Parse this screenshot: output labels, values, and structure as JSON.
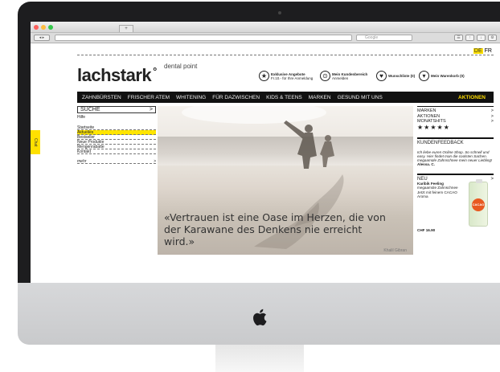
{
  "browser": {
    "tab_label": "+",
    "search_placeholder": "Google",
    "toolbar_icons": [
      "reader",
      "share",
      "download",
      "settings"
    ]
  },
  "site": {
    "lang": {
      "active": "DE",
      "other": "FR"
    },
    "logo": "lachstark",
    "logo_mark": "°",
    "logo_sub": "dental point",
    "header_links": [
      {
        "icon": "star-icon",
        "glyph": "★",
        "title": "Exklusive Angebote",
        "sub": "Fr.10.- für Ihre Anmeldung"
      },
      {
        "icon": "lock-icon",
        "glyph": "🔒",
        "title": "Mein Kundenbereich",
        "sub": "Anmelden"
      },
      {
        "icon": "heart-icon",
        "glyph": "♥",
        "title": "Wunschliste (0)",
        "sub": ""
      },
      {
        "icon": "cart-icon",
        "glyph": "🛒",
        "title": "Mein Warenkorb (0)",
        "sub": ""
      }
    ],
    "nav": [
      "ZAHNBÜRSTEN",
      "FRISCHER ATEM",
      "WHITENING",
      "FÜR DAZWISCHEN",
      "KIDS & TEENS",
      "MARKEN",
      "GESUND MIT UNS"
    ],
    "nav_highlight": "AKTIONEN",
    "left": {
      "search_label": "SUCHE",
      "search_arrow": ">",
      "help": "Hilfe",
      "items": [
        "Startseite",
        "Aktuelles",
        "Bestseller",
        "Neue Produkte",
        "Mengenrabatte",
        "Kontakt"
      ],
      "active_item": "Aktuelles",
      "more": "mehr",
      "more_arrow": ">"
    },
    "hero": {
      "quote": "«Vertrauen ist eine Oase im Herzen, die von der Karawane des Denkens nie erreicht wird.»",
      "credit": "Khalil Gibran"
    },
    "right": {
      "links": [
        {
          "label": "MARKEN",
          "arrow": ">"
        },
        {
          "label": "AKTIONEN",
          "arrow": ">"
        },
        {
          "label": "MONATSHITS",
          "arrow": ">"
        }
      ],
      "stars": "★★★★★",
      "feedback_title": "KUNDENFEEDBACK",
      "feedback_text": "Ich liebe euren Online Shop. So schnell und easy. Hier findet man die coolsten Sachen. megaamüle Zahnschnee mein neuer Liebling!",
      "feedback_author": "Alessa. C.",
      "new_title": "NEU",
      "new_arrow": ">",
      "product_name": "Karibik Feeling",
      "product_desc": "megaamüle Zahnschnee Jetzt mit feinem CACAO Aroma",
      "product_badge": "CACAO",
      "price": "CHF 16.90"
    },
    "side_tag": "Chat"
  },
  "colors": {
    "accent": "#ffe500",
    "nav_bg": "#111111",
    "nav_highlight": "#ffdd00"
  }
}
